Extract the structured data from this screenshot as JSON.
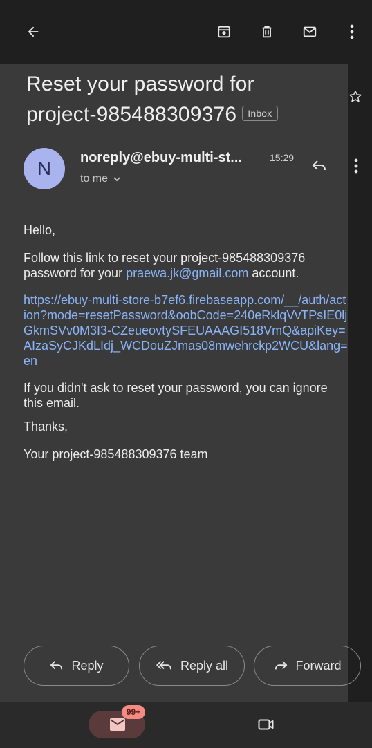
{
  "toolbar": {
    "back_icon": "back-arrow-icon",
    "archive_icon": "archive-icon",
    "delete_icon": "trash-icon",
    "mark_unread_icon": "mail-icon",
    "more_icon": "more-vert-icon"
  },
  "email": {
    "subject_line1": "Reset your password for",
    "subject_line2": "project-985488309376",
    "label_badge": "Inbox",
    "sender_initial": "N",
    "sender": "noreply@ebuy-multi-st...",
    "time": "15:29",
    "recipient": "to me",
    "body": {
      "greeting": "Hello,",
      "follow_text": "Follow this link to reset your project-985488309376 password for your ",
      "email_link": "praewa.jk@gmail.com",
      "follow_suffix": " account.",
      "reset_url": "https://ebuy-multi-store-b7ef6.firebaseapp.com/__/auth/action?mode=resetPassword&oobCode=240eRklqVvTPsIE0ljGkmSVv0M3I3-CZeueovtySFEUAAAGI518VmQ&apiKey=AIzaSyCJKdLIdj_WCDouZJmas08mwehrckp2WCU&lang=en",
      "ignore_text": "If you didn't ask to reset your password, you can ignore this email.",
      "thanks": "Thanks,",
      "signature": "Your project-985488309376 team"
    }
  },
  "actions": {
    "reply": "Reply",
    "reply_all": "Reply all",
    "forward": "Forward"
  },
  "bottom_nav": {
    "mail_badge": "99+"
  },
  "colors": {
    "background": "#1f1f1f",
    "panel": "#3a3a3a",
    "link": "#8ab4f8",
    "avatar": "#a9b4ef",
    "badge": "#f28b82"
  }
}
